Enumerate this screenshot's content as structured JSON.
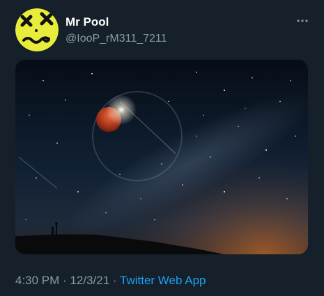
{
  "tweet": {
    "display_name": "Mr Pool",
    "handle": "@IooP_rM311_7211",
    "time": "4:30 PM",
    "date": "12/3/21",
    "separator": "·",
    "source": "Twitter Web App"
  },
  "icons": {
    "avatar": "yellow-dead-smiley-avatar",
    "more": "more-horizontal-icon"
  },
  "colors": {
    "background": "#15202b",
    "text_primary": "#ffffff",
    "text_secondary": "#8899a6",
    "link": "#1da1f2",
    "avatar_yellow": "#e8ec3a"
  }
}
